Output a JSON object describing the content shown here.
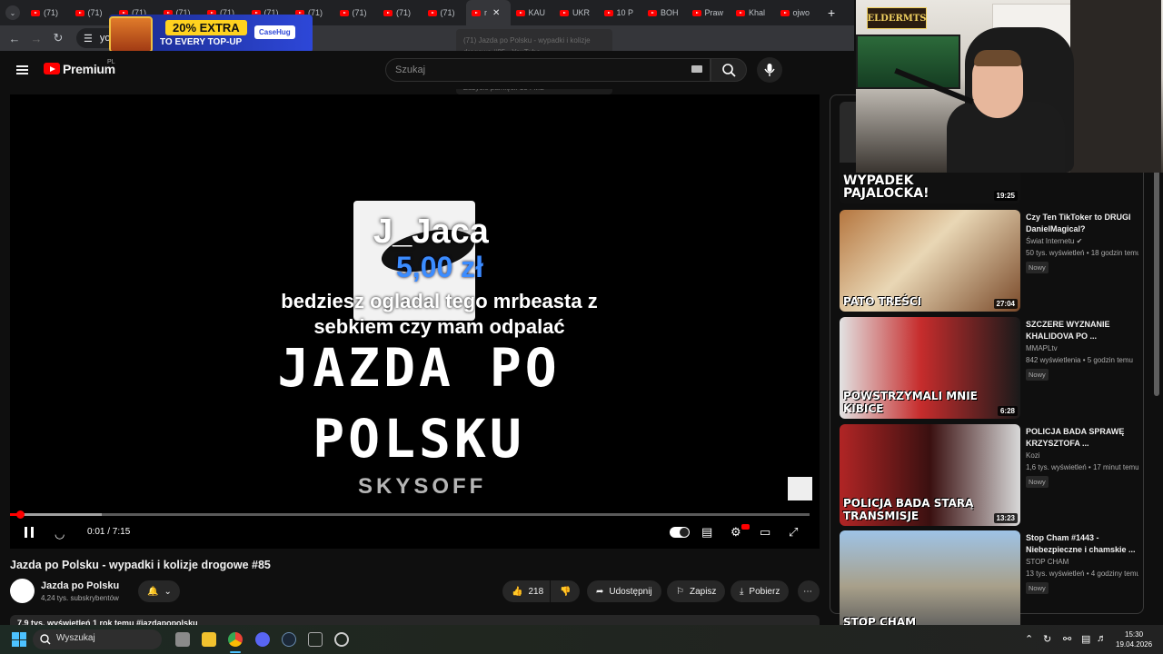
{
  "browser": {
    "tabs": [
      {
        "label": "(71)"
      },
      {
        "label": "(71)"
      },
      {
        "label": "(71)"
      },
      {
        "label": "(71)"
      },
      {
        "label": "(71)"
      },
      {
        "label": "(71)"
      },
      {
        "label": "(71)"
      },
      {
        "label": "(71)"
      },
      {
        "label": "(71)"
      },
      {
        "label": "(71)"
      },
      {
        "label": "r",
        "active": true
      },
      {
        "label": "KAU"
      },
      {
        "label": "UKR"
      },
      {
        "label": "10 P"
      },
      {
        "label": "BOH"
      },
      {
        "label": "Praw"
      },
      {
        "label": "Khal"
      },
      {
        "label": "ojwo"
      }
    ],
    "address": "you",
    "tooltip_lines": [
      "(71) Jazda po Polsku - wypadki i kolizje",
      "drogowe #85 - YouTube",
      "youtube.com",
      "",
      "Zużycie pamięci: 134 MB"
    ]
  },
  "ad": {
    "headline": "20% EXTRA",
    "subline": "TO EVERY TOP-UP",
    "brand": "CaseHug"
  },
  "header": {
    "brand": "Premium",
    "region": "PL",
    "search_placeholder": "Szukaj"
  },
  "player": {
    "donation_name": "J_Jaca",
    "donation_amount": "5,00 zł",
    "donation_message": "bedziesz ogladal tego mrbeasta z sebkiem czy mam odpalać",
    "title_line1": "JAZDA PO",
    "title_line2": "POLSKU",
    "watermark": "SKYSOFF",
    "timecode": "0:01 / 7:15",
    "progress_fraction": 0.001,
    "buffer_fraction": 0.115
  },
  "video": {
    "title": "Jazda po Polsku - wypadki i kolizje drogowe #85",
    "channel": "Jazda po Polsku",
    "subscribers": "4,24 tys. subskrybentów",
    "likes": "218",
    "share": "Udostępnij",
    "save": "Zapisz",
    "download": "Pobierz",
    "description_preview": "7,9 tys. wyświetleń  1 rok temu  #jazdapopolsku"
  },
  "sidebar": {
    "items": [
      {
        "title": "",
        "channel": "",
        "meta": "",
        "duration": "19:25",
        "thumb_text": "WYPADEK PAJALOCKA!",
        "badge": ""
      },
      {
        "title": "Czy Ten TikToker to DRUGI DanielMagical?",
        "channel": "Świat Internetu",
        "verified": true,
        "meta": "50 tys. wyświetleń • 18 godzin temu",
        "duration": "27:04",
        "thumb_text": "PATO TREŚCI",
        "badge": "Nowy"
      },
      {
        "title": "SZCZERE WYZNANIE KHALIDOVA PO ...",
        "channel": "MMAPLtv",
        "meta": "842 wyświetlenia • 5 godzin temu",
        "duration": "6:28",
        "thumb_text": "POWSTRZYMALI MNIE KIBICE",
        "badge": "Nowy"
      },
      {
        "title": "POLICJA BADA SPRAWĘ KRZYSZTOFA ...",
        "channel": "Kozi",
        "meta": "1,6 tys. wyświetleń • 17 minut temu",
        "duration": "13:23",
        "thumb_text": "POLICJA BADA STARĄ TRANSMISJE",
        "badge": "Nowy"
      },
      {
        "title": "Stop Cham #1443 - Niebezpieczne i chamskie ...",
        "channel": "STOP CHAM",
        "meta": "13 tys. wyświetleń • 4 godziny temu",
        "duration": "",
        "thumb_text": "STOP CHAM",
        "badge": "Nowy"
      }
    ]
  },
  "webcam": {
    "logo": "ELDERMTS"
  },
  "taskbar": {
    "search_placeholder": "Wyszukaj",
    "time": "15:30",
    "date": "19.04.2026"
  }
}
